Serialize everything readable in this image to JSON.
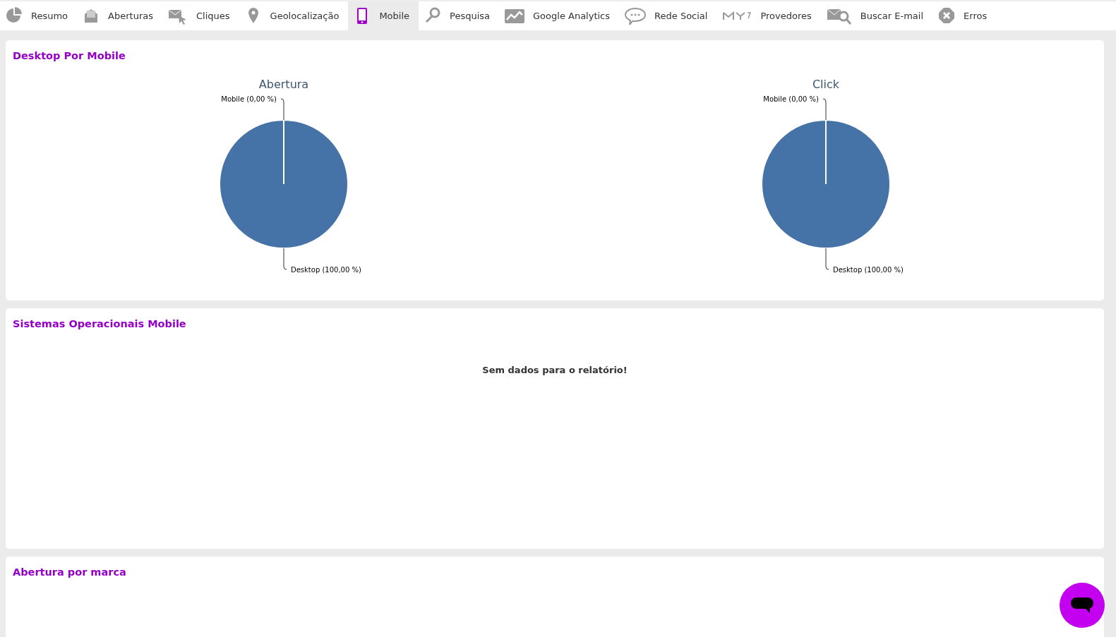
{
  "tabs": [
    {
      "label": "Resumo",
      "selected": false
    },
    {
      "label": "Aberturas",
      "selected": false
    },
    {
      "label": "Cliques",
      "selected": false
    },
    {
      "label": "Geolocalização",
      "selected": false
    },
    {
      "label": "Mobile",
      "selected": true
    },
    {
      "label": "Pesquisa",
      "selected": false
    },
    {
      "label": "Google Analytics",
      "selected": false
    },
    {
      "label": "Rede Social",
      "selected": false
    },
    {
      "label": "Provedores",
      "selected": false
    },
    {
      "label": "Buscar E-mail",
      "selected": false
    },
    {
      "label": "Erros",
      "selected": false
    }
  ],
  "sections": [
    {
      "title": "Desktop Por Mobile",
      "kind": "charts",
      "charts": [
        {
          "chart_data": {
            "type": "pie",
            "title": "Abertura",
            "categories": [
              "Mobile",
              "Desktop"
            ],
            "series": [
              {
                "color": "#4572a7",
                "values": [
                  0,
                  100
                ]
              }
            ],
            "value_labels": [
              "(0,00 %)",
              "(100,00 %)"
            ]
          }
        },
        {
          "chart_data": {
            "type": "pie",
            "title": "Click",
            "categories": [
              "Mobile",
              "Desktop"
            ],
            "series": [
              {
                "color": "#4572a7",
                "values": [
                  0,
                  100
                ]
              }
            ],
            "value_labels": [
              "(0,00 %)",
              "(100,00 %)"
            ]
          }
        }
      ]
    },
    {
      "title": "Sistemas Operacionais Mobile",
      "kind": "empty",
      "message": "Sem dados para o relatório!"
    },
    {
      "title": "Abertura por marca",
      "kind": "partial"
    }
  ]
}
